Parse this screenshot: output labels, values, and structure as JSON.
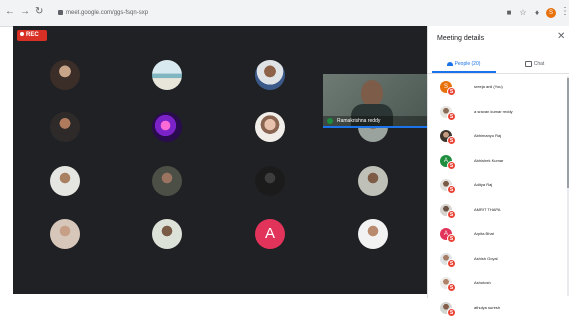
{
  "browser": {
    "url": "meet.google.com/ggs-fsqn-sxp"
  },
  "meeting": {
    "rec_label": "REC",
    "speaker_name": "Ramakrishna reddy",
    "grid": [
      {
        "kind": "photo",
        "style": "ph1"
      },
      {
        "kind": "photo",
        "style": "ph2"
      },
      {
        "kind": "photo",
        "style": "ph3"
      },
      {
        "kind": "photo",
        "style": "ph4"
      },
      {
        "kind": "photo",
        "style": "ph5"
      },
      {
        "kind": "photo",
        "style": "ph6"
      },
      {
        "kind": "photo",
        "style": "ph7"
      },
      {
        "kind": "photo",
        "style": "ph8"
      },
      {
        "kind": "photo",
        "style": "ph9"
      },
      {
        "kind": "photo",
        "style": "ph10"
      },
      {
        "kind": "photo",
        "style": "ph11"
      },
      {
        "kind": "photo",
        "style": "ph12"
      },
      {
        "kind": "photo",
        "style": "ph13"
      },
      {
        "kind": "letter",
        "letter": "A",
        "color": "#e2335a"
      },
      {
        "kind": "photo",
        "style": "ph14"
      }
    ]
  },
  "panel": {
    "title": "Meeting details",
    "tabs": {
      "people": "People (20)",
      "chat": "Chat"
    },
    "participants": [
      {
        "name": "sreeja anil (You)",
        "avatar": "av-o",
        "letter": "S"
      },
      {
        "name": "a sravan kumar reddy",
        "avatar": "av-p1",
        "letter": ""
      },
      {
        "name": "Abhimanyu Raj",
        "avatar": "av-p2",
        "letter": ""
      },
      {
        "name": "Abhishek Kumar",
        "avatar": "av-a",
        "letter": "A"
      },
      {
        "name": "Aditya Raj",
        "avatar": "av-p3",
        "letter": ""
      },
      {
        "name": "AMRIT THAPA",
        "avatar": "av-p4",
        "letter": ""
      },
      {
        "name": "Arpita Bhat",
        "avatar": "av-pink",
        "letter": "A"
      },
      {
        "name": "Ashish Goyal",
        "avatar": "av-p5",
        "letter": ""
      },
      {
        "name": "Ashutosh",
        "avatar": "av-p7",
        "letter": ""
      },
      {
        "name": "athulya suresh",
        "avatar": "av-p8",
        "letter": ""
      }
    ],
    "badge_letter": "S"
  },
  "colors": {
    "stage_bg": "#202124",
    "accent": "#1a73e8",
    "rec": "#d93025",
    "badge": "#ea4335"
  }
}
